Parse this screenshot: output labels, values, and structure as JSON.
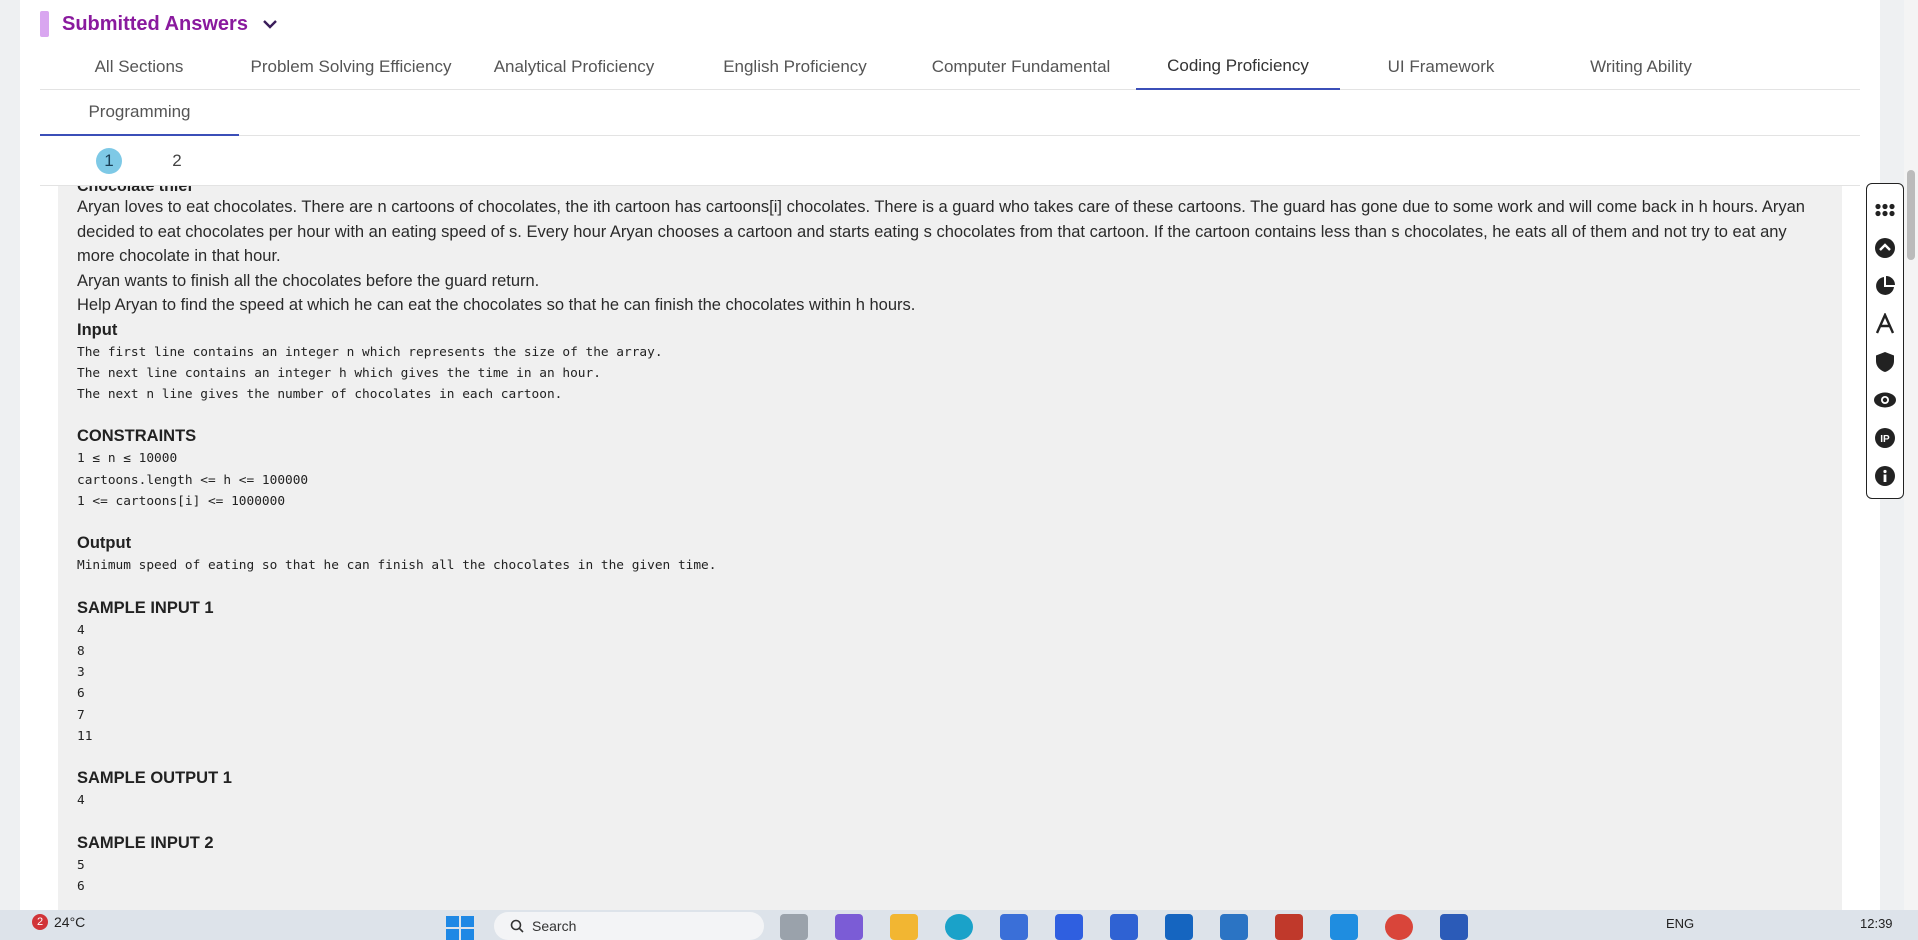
{
  "header": {
    "title": "Submitted Answers"
  },
  "tabs": [
    "All Sections",
    "Problem Solving Efficiency",
    "Analytical Proficiency",
    "English Proficiency",
    "Computer Fundamental",
    "Coding Proficiency",
    "UI Framework",
    "Writing Ability"
  ],
  "tab2": "Programming",
  "active_tab": "Coding Proficiency",
  "pages": [
    "1",
    "2"
  ],
  "question": {
    "cut_title": "Chocolate thief",
    "para1": "Aryan loves to eat chocolates. There are n cartoons of chocolates, the ith cartoon has cartoons[i] chocolates. There is a guard who takes care of these cartoons. The guard has gone due to some work and will come back in h hours. Aryan decided to eat chocolates per hour with an eating speed of s. Every hour Aryan chooses a cartoon and starts eating s chocolates from that cartoon. If the cartoon contains less than s chocolates, he eats all of them and not try to eat any more chocolate in that hour.",
    "para2": "Aryan wants to finish all the chocolates before the guard return.",
    "para3": "Help Aryan to find the speed at which he can eat the chocolates so that he can finish the chocolates within h hours.",
    "input_heading": "Input",
    "input_lines": [
      "The first line contains an integer n which represents the size of the array.",
      "The next line contains an integer h which gives the time in an hour.",
      "The next n line gives the number of chocolates in each cartoon."
    ],
    "constraints_heading": "CONSTRAINTS",
    "constraints": [
      "1 ≤ n ≤ 10000",
      "cartoons.length <= h <= 100000",
      "1 <= cartoons[i] <= 1000000"
    ],
    "output_heading": "Output",
    "output_line": "Minimum speed of eating so that he can finish all the chocolates in the given time.",
    "sample_input_1_heading": "SAMPLE INPUT 1",
    "sample_input_1": [
      "4",
      "8",
      "3",
      "6",
      "7",
      "11"
    ],
    "sample_output_1_heading": "SAMPLE OUTPUT 1",
    "sample_output_1": [
      "4"
    ],
    "sample_input_2_heading": "SAMPLE INPUT 2",
    "sample_input_2": [
      "5",
      "6"
    ]
  },
  "taskbar": {
    "weather": "24°C",
    "notification_count": "2",
    "search": "Search",
    "language": "ENG",
    "time": "12:39"
  }
}
